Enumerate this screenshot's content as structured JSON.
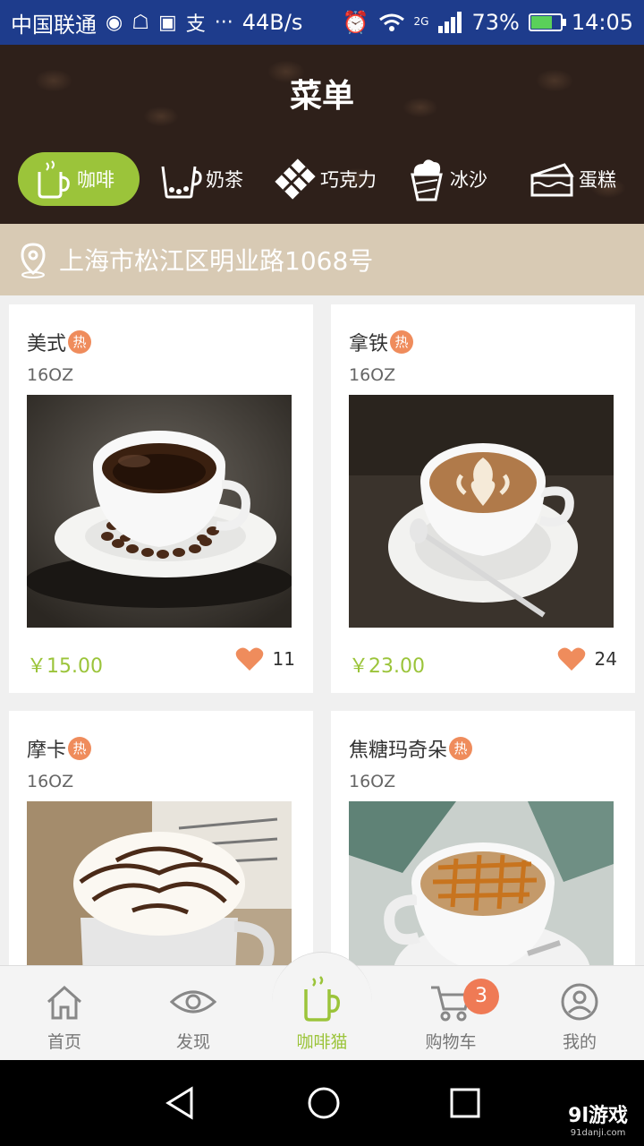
{
  "status_bar": {
    "carrier": "中国联通",
    "speed": "44B/s",
    "network": "2G",
    "battery": "73%",
    "battery_level": 0.73,
    "time": "14:05"
  },
  "header": {
    "title": "菜单",
    "categories": [
      {
        "label": "咖啡",
        "icon": "coffee-cup-icon",
        "active": true
      },
      {
        "label": "奶茶",
        "icon": "milk-tea-icon",
        "active": false
      },
      {
        "label": "巧克力",
        "icon": "chocolate-icon",
        "active": false
      },
      {
        "label": "冰沙",
        "icon": "smoothie-icon",
        "active": false
      },
      {
        "label": "蛋糕",
        "icon": "cake-icon",
        "active": false
      }
    ]
  },
  "address": {
    "text": "上海市松江区明业路1068号",
    "icon": "location-pin-icon"
  },
  "products": [
    {
      "name": "美式",
      "hot_badge": "热",
      "size": "16OZ",
      "price": "￥15.00",
      "likes": "11",
      "image": "black-coffee-cup"
    },
    {
      "name": "拿铁",
      "hot_badge": "热",
      "size": "16OZ",
      "price": "￥23.00",
      "likes": "24",
      "image": "latte-art-cup"
    },
    {
      "name": "摩卡",
      "hot_badge": "热",
      "size": "16OZ",
      "price": "",
      "likes": "",
      "image": "mocha-whipped-cream"
    },
    {
      "name": "焦糖玛奇朵",
      "hot_badge": "热",
      "size": "16OZ",
      "price": "",
      "likes": "",
      "image": "caramel-macchiato-cup"
    }
  ],
  "bottom_nav": [
    {
      "label": "首页",
      "icon": "home-icon",
      "active": false
    },
    {
      "label": "发现",
      "icon": "eye-icon",
      "active": false
    },
    {
      "label": "咖啡猫",
      "icon": "coffee-cup-icon",
      "active": true
    },
    {
      "label": "购物车",
      "icon": "cart-icon",
      "active": false,
      "badge": "3"
    },
    {
      "label": "我的",
      "icon": "profile-icon",
      "active": false
    }
  ],
  "watermark": {
    "main": "9l游戏",
    "sub": "91danji.com"
  },
  "colors": {
    "accent": "#9bc43a",
    "hot": "#ef8c5c",
    "header_bg": "#2e201a",
    "address_bg": "#d8cab4",
    "statusbar": "#1e3c8c"
  }
}
